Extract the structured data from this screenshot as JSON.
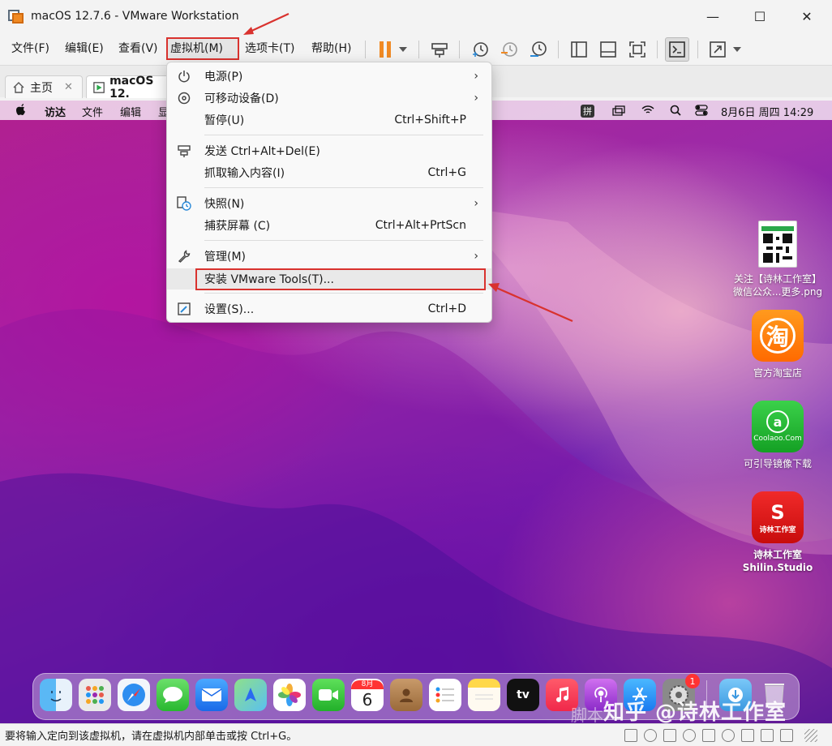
{
  "window": {
    "title": "macOS 12.7.6 - VMware Workstation",
    "minimize_glyph": "—",
    "maximize_glyph": "☐",
    "close_glyph": "✕"
  },
  "menubar": {
    "items": [
      "文件(F)",
      "编辑(E)",
      "查看(V)",
      "虚拟机(M)",
      "选项卡(T)",
      "帮助(H)"
    ],
    "highlighted": "虚拟机(M)"
  },
  "toolbar": {
    "icons": [
      "pause-icon",
      "dropdown-icon",
      "send-ctrl-alt-del-icon",
      "snapshot-take-icon",
      "snapshot-revert-icon",
      "snapshot-manager-icon",
      "view-library-icon",
      "view-thumbnail-icon",
      "fullscreen-icon",
      "console-icon",
      "stretch-icon",
      "dropdown-icon"
    ],
    "accent": "#f08a24"
  },
  "tabs": [
    {
      "label": "主页",
      "icon": "home-icon",
      "active": false
    },
    {
      "label": "macOS 12.",
      "icon": "vm-running-icon",
      "active": true
    }
  ],
  "mac_menubar": {
    "apple": "",
    "items": [
      "访达",
      "文件",
      "编辑",
      "显"
    ],
    "right": {
      "input": "拼",
      "datetime": "8月6日 周四  14:29"
    }
  },
  "vm_menu": {
    "items": [
      {
        "label": "电源(P)",
        "shortcut": "",
        "submenu": true,
        "icon": "power-icon"
      },
      {
        "label": "可移动设备(D)",
        "shortcut": "",
        "submenu": true,
        "icon": "removable-devices-icon"
      },
      {
        "label": "暂停(U)",
        "shortcut": "Ctrl+Shift+P",
        "submenu": false,
        "icon": ""
      },
      {
        "label": "发送 Ctrl+Alt+Del(E)",
        "shortcut": "",
        "submenu": false,
        "icon": "send-keys-icon"
      },
      {
        "label": "抓取输入内容(I)",
        "shortcut": "Ctrl+G",
        "submenu": false,
        "icon": ""
      },
      {
        "label": "快照(N)",
        "shortcut": "",
        "submenu": true,
        "icon": "snapshot-icon"
      },
      {
        "label": "捕获屏幕 (C)",
        "shortcut": "Ctrl+Alt+PrtScn",
        "submenu": false,
        "icon": ""
      },
      {
        "label": "管理(M)",
        "shortcut": "",
        "submenu": true,
        "icon": "wrench-icon"
      },
      {
        "label": "安装 VMware Tools(T)...",
        "shortcut": "",
        "submenu": false,
        "icon": ""
      },
      {
        "label": "设置(S)...",
        "shortcut": "Ctrl+D",
        "submenu": false,
        "icon": "settings-icon"
      }
    ],
    "submenu_glyph": "›"
  },
  "desktop_icons": [
    {
      "label_line1": "关注【诗林工作室】",
      "label_line2": "微信公众...更多.png",
      "icon": "qr-code-icon"
    },
    {
      "label_line1": "官方淘宝店",
      "label_line2": "",
      "icon": "taobao-icon",
      "glyph": "淘"
    },
    {
      "label_line1": "可引导镜像下载",
      "label_line2": "",
      "icon": "coolaoo-icon",
      "glyph": "a",
      "sub": "Coolaoo.Com"
    },
    {
      "label_line1": "诗林工作室",
      "label_line2": "Shilin.Studio",
      "icon": "shilin-studio-icon",
      "glyph": "S",
      "sub": "诗林工作室"
    }
  ],
  "dock": {
    "calendar_month": "8月",
    "calendar_day": "6",
    "tv_label": "tv",
    "badge": "1"
  },
  "status_bar": {
    "text": "要将输入定向到该虚拟机，请在虚拟机内部单击或按 Ctrl+G。"
  },
  "watermark": {
    "text": "知乎 @诗林工作室",
    "prefix": "脚本"
  },
  "colors": {
    "highlight_box": "#d9322e",
    "arrow": "#d9322e"
  }
}
